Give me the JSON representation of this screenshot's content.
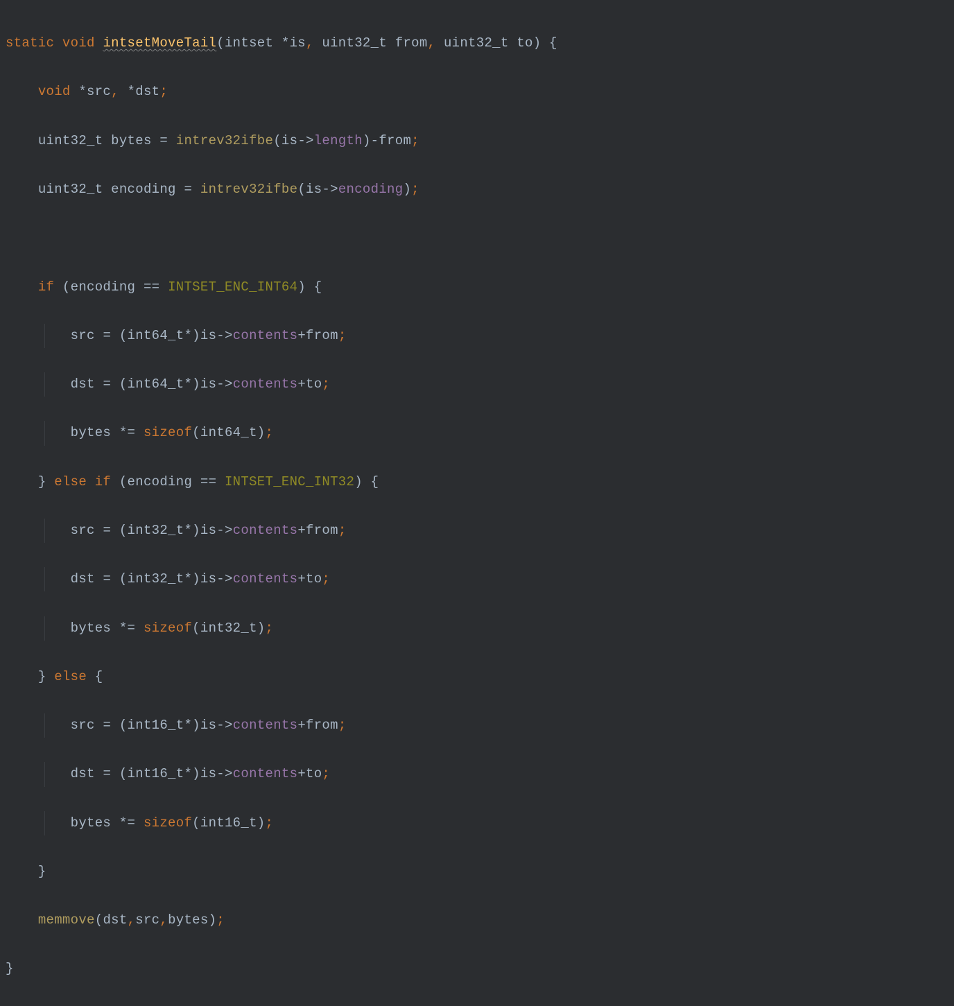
{
  "tokens": {
    "static": "static",
    "void": "void",
    "fn_name": "intsetMoveTail",
    "intset": "intset",
    "star": "*",
    "is": "is",
    "comma": ",",
    "uint32_t": "uint32_t",
    "from": "from",
    "to": "to",
    "lparen": "(",
    "rparen": ")",
    "lbrace": "{",
    "rbrace": "}",
    "src": "src",
    "dst": "dst",
    "semi": ";",
    "bytes": "bytes",
    "eq": "=",
    "intrev32ifbe": "intrev32ifbe",
    "arrow": "->",
    "length": "length",
    "minus": "-",
    "encoding_var": "encoding",
    "encoding_mem": "encoding",
    "if": "if",
    "else": "else",
    "eqeq": "==",
    "INTSET_ENC_INT64": "INTSET_ENC_INT64",
    "INTSET_ENC_INT32": "INTSET_ENC_INT32",
    "int64_t": "int64_t",
    "int32_t": "int32_t",
    "int16_t": "int16_t",
    "contents": "contents",
    "plus": "+",
    "stareq": "*=",
    "sizeof": "sizeof",
    "memmove": "memmove"
  }
}
